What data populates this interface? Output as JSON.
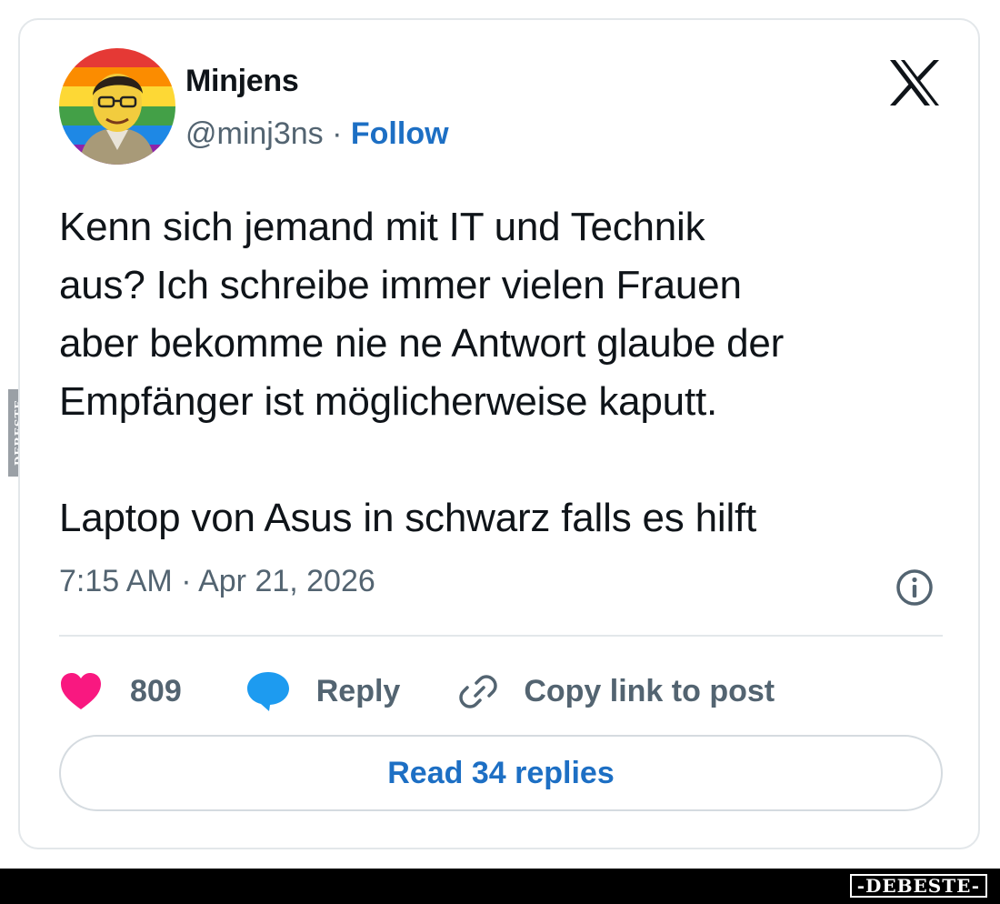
{
  "author": {
    "display_name": "Minjens",
    "handle": "@minj3ns",
    "separator": " · ",
    "follow_label": "Follow",
    "avatar_icon": "profile-avatar-rainbow"
  },
  "platform_icon": "x-logo-icon",
  "tweet": {
    "text": "Kenn sich jemand mit IT und Technik\naus? Ich schreibe immer vielen Frauen\naber bekomme nie ne Antwort glaube der\nEmpfänger ist möglicherweise kaputt.\n\nLaptop von Asus in schwarz falls es hilft",
    "timestamp": "7:15 AM · Apr 21, 2026"
  },
  "actions": {
    "like_count": "809",
    "reply_label": "Reply",
    "copy_link_label": "Copy link to post",
    "read_replies_label": "Read 34 replies"
  },
  "watermark": {
    "side_text": "DEBESTE",
    "brand_text": "-DEBESTE-"
  },
  "colors": {
    "accent": "#1d6fc4",
    "like": "#f91880",
    "reply_bubble": "#1d9bf0",
    "text_primary": "#0f1419",
    "text_secondary": "#536471"
  }
}
